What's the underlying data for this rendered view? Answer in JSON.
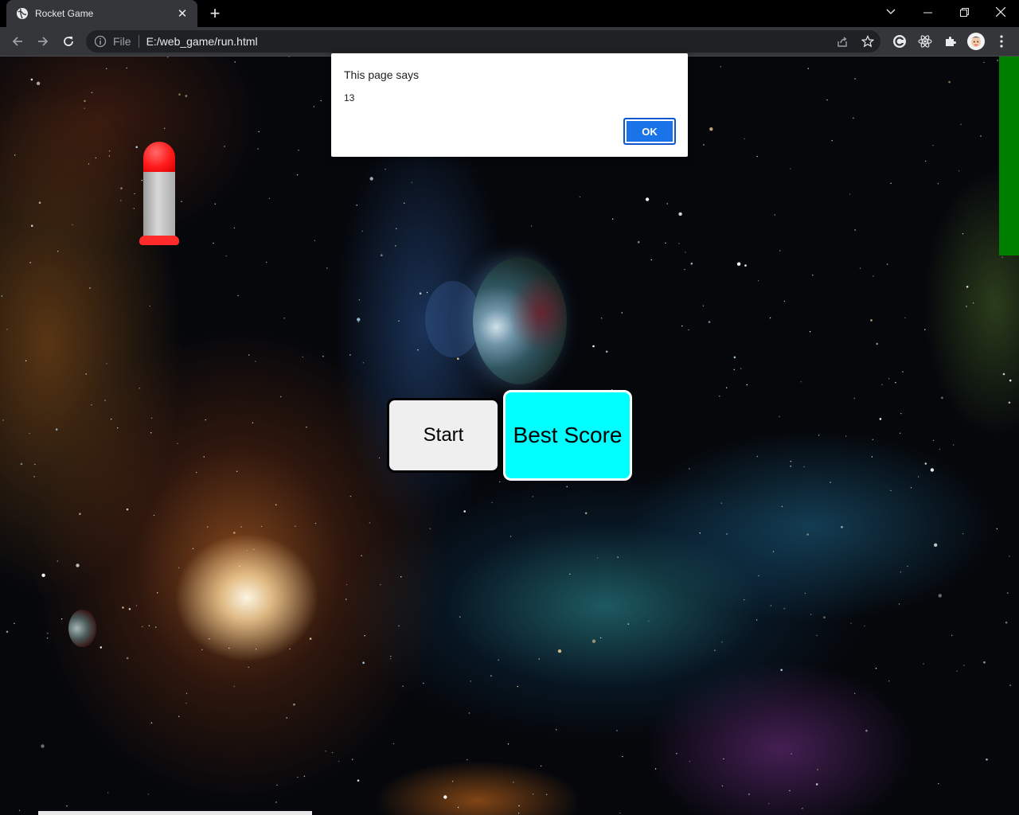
{
  "browser": {
    "tab": {
      "title": "Rocket Game",
      "close_glyph": "✕",
      "favicon": "globe-icon"
    },
    "new_tab_glyph": "+",
    "address_bar": {
      "scheme_label": "File",
      "url": "E:/web_game/run.html"
    },
    "window_controls": [
      "tab-search-icon",
      "minimize-icon",
      "restore-icon",
      "close-icon"
    ],
    "extensions": [
      "share-icon",
      "star-icon",
      "extension-c-icon",
      "react-icon",
      "puzzle-icon",
      "profile-avatar",
      "more-icon"
    ]
  },
  "game": {
    "buttons": {
      "start": "Start",
      "best_score": "Best Score"
    },
    "colors": {
      "best_score_bg": "#00ffff",
      "start_bg": "#efefef",
      "level_bar": "#008000",
      "rocket_nose": "#ff1a1a",
      "rocket_body": "#c0c0c0"
    }
  },
  "dialog": {
    "title": "This page says",
    "message": "13",
    "ok_label": "OK",
    "ok_color": "#1a73e8"
  }
}
